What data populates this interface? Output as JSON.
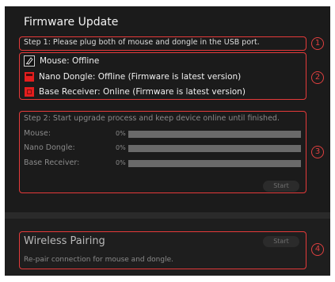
{
  "window": {
    "title": "Firmware Update"
  },
  "step1": {
    "text": "Step 1: Please plug both of mouse and dongle in the USB port.",
    "marker": "1"
  },
  "devices": {
    "marker": "2",
    "items": [
      {
        "icon": "mouse-icon",
        "label": "Mouse: Offline"
      },
      {
        "icon": "nano-dongle-icon",
        "label": "Nano Dongle: Offline (Firmware is latest version)"
      },
      {
        "icon": "base-receiver-icon",
        "label": "Base Receiver: Online (Firmware is latest version)"
      }
    ]
  },
  "upgrade": {
    "marker": "3",
    "header": "Step 2: Start upgrade process and keep device online until finished.",
    "rows": [
      {
        "label": "Mouse:",
        "percent_label": "0%",
        "progress": 0
      },
      {
        "label": "Nano Dongle:",
        "percent_label": "0%",
        "progress": 0
      },
      {
        "label": "Base Receiver:",
        "percent_label": "0%",
        "progress": 0
      }
    ],
    "start_label": "Start"
  },
  "pairing": {
    "marker": "4",
    "title": "Wireless Pairing",
    "description": "Re-pair connection for mouse and dongle.",
    "start_label": "Start"
  },
  "colors": {
    "highlight": "#e53a3a",
    "status_red": "#e41e1e",
    "panel_bg": "#1b1b1b"
  }
}
